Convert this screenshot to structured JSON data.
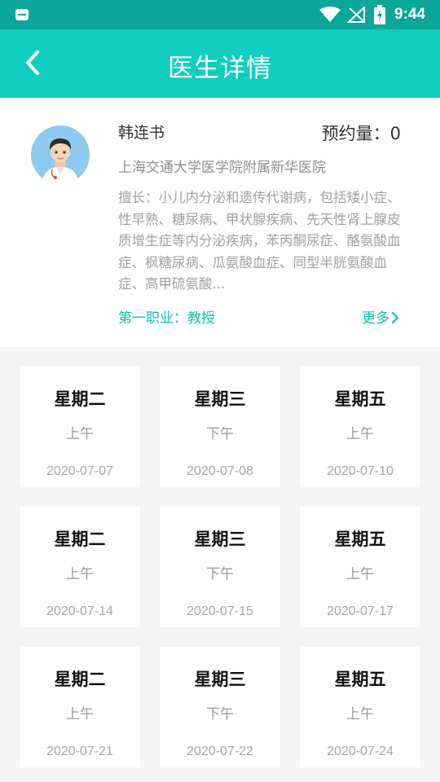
{
  "status_bar": {
    "time": "9:44"
  },
  "header": {
    "title": "医生详情"
  },
  "doctor": {
    "name": "韩连书",
    "appointment_label": "预约量：",
    "appointment_count": "0",
    "hospital": "上海交通大学医学院附属新华医院",
    "specialty": "擅长：小儿内分泌和遗传代谢病，包括矮小症、性早熟、糖尿病、甲状腺疾病、先天性肾上腺皮质增生症等内分泌疾病，苯丙酮尿症、酪氨酸血症、枫糖尿病、瓜氨酸血症、同型半胱氨酸血症、高甲硫氨酸...",
    "title": "第一职业：教授",
    "more_label": "更多"
  },
  "schedule": [
    {
      "day": "星期二",
      "period": "上午",
      "date": "2020-07-07"
    },
    {
      "day": "星期三",
      "period": "下午",
      "date": "2020-07-08"
    },
    {
      "day": "星期五",
      "period": "上午",
      "date": "2020-07-10"
    },
    {
      "day": "星期二",
      "period": "上午",
      "date": "2020-07-14"
    },
    {
      "day": "星期三",
      "period": "下午",
      "date": "2020-07-15"
    },
    {
      "day": "星期五",
      "period": "上午",
      "date": "2020-07-17"
    },
    {
      "day": "星期二",
      "period": "上午",
      "date": "2020-07-21"
    },
    {
      "day": "星期三",
      "period": "下午",
      "date": "2020-07-22"
    },
    {
      "day": "星期五",
      "period": "上午",
      "date": "2020-07-24"
    }
  ],
  "colors": {
    "accent": "#11cdbf",
    "status_bar": "#0aa79a",
    "link": "#11bfb1"
  },
  "icons": [
    "app-notification-icon",
    "wifi-icon",
    "signal-icon",
    "battery-icon",
    "back-arrow-icon",
    "doctor-avatar",
    "chevron-right-icon"
  ]
}
